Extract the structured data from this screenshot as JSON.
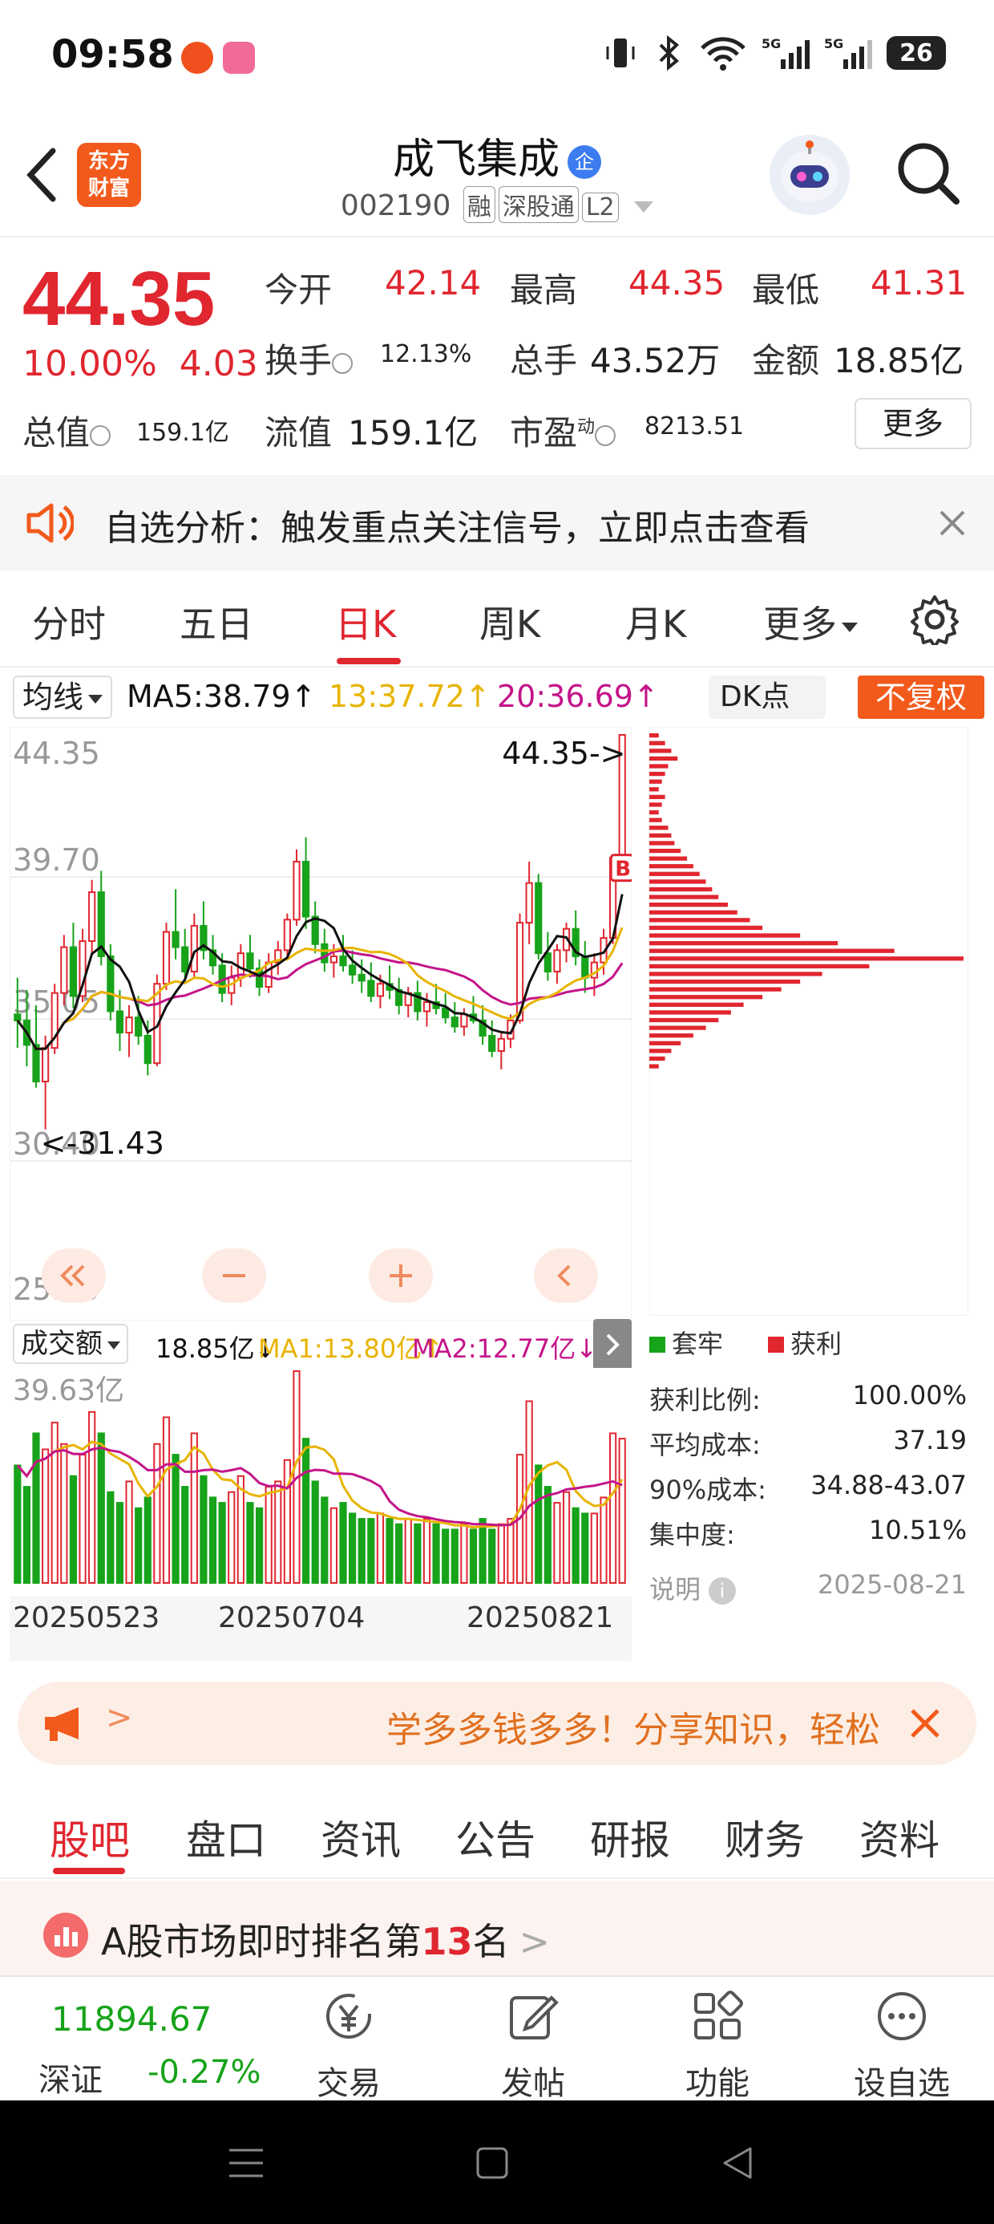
{
  "status_bar": {
    "time": "09:58",
    "battery": "26"
  },
  "header": {
    "logo_line1": "东方",
    "logo_line2": "财富",
    "stock_name": "成飞集成",
    "badge": "企",
    "code": "002190",
    "tags": [
      "融",
      "深股通",
      "L2"
    ]
  },
  "quote": {
    "price": "44.35",
    "change_pct": "10.00%",
    "change": "4.03",
    "open_label": "今开",
    "open": "42.14",
    "high_label": "最高",
    "high": "44.35",
    "low_label": "最低",
    "low": "41.31",
    "turnover_label": "换手",
    "turnover": "12.13%",
    "volume_label": "总手",
    "volume": "43.52万",
    "amount_label": "金额",
    "amount": "18.85亿",
    "mktcap_label": "总值",
    "mktcap": "159.1亿",
    "float_label": "流值",
    "float": "159.1亿",
    "pe_label": "市盈",
    "pe_sup": "动",
    "pe": "8213.51",
    "more": "更多"
  },
  "notice": {
    "text": "自选分析：触发重点关注信号，立即点击查看"
  },
  "chart_tabs": [
    {
      "label": "分时"
    },
    {
      "label": "五日"
    },
    {
      "label": "日K"
    },
    {
      "label": "周K"
    },
    {
      "label": "月K"
    },
    {
      "label": "更多"
    }
  ],
  "ma_row": {
    "select": "均线",
    "ma5": "MA5:38.79↑",
    "ma13": "13:37.72↑",
    "ma20": "20:36.69↑",
    "dk": "DK点",
    "fq": "不复权"
  },
  "colors": {
    "up": "#e0262f",
    "down": "#17a31a",
    "ma5": "#111111",
    "ma13": "#e8b400",
    "ma20": "#c4148a",
    "accent": "#f25a1c"
  },
  "chart_data": {
    "type": "candlestick",
    "y_ticks": [
      "44.35",
      "39.70",
      "35.05",
      "30.40",
      "25.75"
    ],
    "ylim": [
      25.75,
      44.35
    ],
    "max_label": "44.35->",
    "min_label": "<-31.43",
    "buy_marker": "B",
    "volume": {
      "select": "成交额",
      "value": "18.85亿↓",
      "ma1": "MA1:13.80亿↑",
      "ma2": "MA2:12.77亿↓",
      "max_label": "39.63亿"
    },
    "x_labels": [
      "20250523",
      "20250704",
      "20250821"
    ],
    "candles": [
      [
        35.2,
        36.4,
        34.1,
        35.0
      ],
      [
        35.0,
        36.0,
        33.5,
        34.2
      ],
      [
        34.2,
        35.5,
        32.8,
        33.0
      ],
      [
        33.0,
        34.5,
        31.43,
        34.1
      ],
      [
        34.1,
        36.2,
        33.9,
        35.9
      ],
      [
        35.9,
        37.8,
        35.5,
        37.4
      ],
      [
        37.4,
        38.2,
        35.4,
        35.8
      ],
      [
        35.8,
        38.0,
        35.6,
        37.6
      ],
      [
        37.6,
        39.6,
        37.2,
        39.2
      ],
      [
        39.2,
        39.9,
        36.8,
        37.1
      ],
      [
        37.1,
        37.5,
        35.0,
        35.3
      ],
      [
        35.3,
        36.0,
        34.0,
        34.6
      ],
      [
        34.6,
        35.5,
        33.8,
        35.1
      ],
      [
        35.1,
        35.8,
        34.2,
        34.5
      ],
      [
        34.5,
        35.0,
        33.2,
        33.6
      ],
      [
        33.6,
        36.5,
        33.5,
        36.2
      ],
      [
        36.2,
        38.2,
        36.0,
        37.9
      ],
      [
        37.9,
        39.3,
        37.0,
        37.4
      ],
      [
        37.4,
        38.0,
        36.2,
        36.6
      ],
      [
        36.6,
        38.5,
        36.4,
        38.1
      ],
      [
        38.1,
        38.9,
        37.0,
        37.3
      ],
      [
        37.3,
        37.8,
        36.5,
        36.8
      ],
      [
        36.8,
        37.2,
        35.6,
        35.9
      ],
      [
        35.9,
        36.8,
        35.5,
        36.4
      ],
      [
        36.4,
        37.5,
        36.1,
        37.2
      ],
      [
        37.2,
        37.8,
        36.4,
        36.7
      ],
      [
        36.7,
        37.0,
        35.8,
        36.1
      ],
      [
        36.1,
        37.2,
        35.9,
        36.9
      ],
      [
        36.9,
        37.6,
        36.5,
        37.3
      ],
      [
        37.3,
        38.5,
        37.0,
        38.3
      ],
      [
        38.3,
        40.6,
        38.1,
        40.2
      ],
      [
        40.2,
        41.0,
        38.0,
        38.4
      ],
      [
        38.4,
        38.9,
        37.2,
        37.5
      ],
      [
        37.5,
        38.0,
        36.6,
        36.9
      ],
      [
        36.9,
        37.5,
        36.4,
        37.1
      ],
      [
        37.1,
        37.8,
        36.6,
        36.8
      ],
      [
        36.8,
        37.3,
        36.2,
        36.5
      ],
      [
        36.5,
        37.0,
        35.9,
        36.3
      ],
      [
        36.3,
        36.9,
        35.6,
        35.8
      ],
      [
        35.8,
        36.5,
        35.4,
        36.2
      ],
      [
        36.2,
        36.8,
        35.7,
        36.0
      ],
      [
        36.0,
        36.4,
        35.2,
        35.5
      ],
      [
        35.5,
        36.1,
        35.1,
        35.9
      ],
      [
        35.9,
        36.3,
        35.0,
        35.3
      ],
      [
        35.3,
        35.9,
        34.8,
        35.6
      ],
      [
        35.6,
        36.2,
        35.2,
        35.4
      ],
      [
        35.4,
        35.9,
        34.9,
        35.1
      ],
      [
        35.1,
        35.6,
        34.6,
        34.8
      ],
      [
        34.8,
        35.4,
        34.5,
        35.2
      ],
      [
        35.2,
        35.8,
        34.9,
        35.0
      ],
      [
        35.0,
        35.5,
        34.2,
        34.5
      ],
      [
        34.5,
        35.0,
        33.8,
        34.0
      ],
      [
        34.0,
        34.6,
        33.4,
        34.4
      ],
      [
        34.4,
        35.2,
        34.1,
        35.0
      ],
      [
        35.0,
        38.5,
        34.9,
        38.2
      ],
      [
        38.2,
        40.2,
        37.5,
        39.5
      ],
      [
        39.5,
        39.8,
        37.0,
        37.2
      ],
      [
        37.2,
        37.9,
        36.3,
        36.6
      ],
      [
        36.6,
        37.5,
        36.2,
        37.3
      ],
      [
        37.3,
        38.2,
        36.9,
        38.0
      ],
      [
        38.0,
        38.6,
        36.8,
        37.1
      ],
      [
        37.1,
        37.6,
        35.9,
        36.4
      ],
      [
        36.4,
        37.2,
        35.8,
        36.9
      ],
      [
        36.9,
        38.0,
        36.5,
        37.7
      ],
      [
        37.7,
        40.3,
        37.5,
        40.32
      ],
      [
        40.32,
        44.35,
        40.2,
        44.35
      ]
    ],
    "volumes": [
      22,
      18,
      28,
      25,
      30,
      26,
      20,
      24,
      32,
      28,
      17,
      15,
      19,
      14,
      16,
      26,
      31,
      24,
      18,
      28,
      20,
      16,
      15,
      17,
      20,
      15,
      14,
      18,
      19,
      23,
      39.63,
      27,
      19,
      16,
      14,
      15,
      13,
      12,
      12,
      13,
      12,
      11,
      12,
      11,
      12,
      11,
      10,
      10,
      11,
      10,
      12,
      10,
      11,
      12,
      24,
      34,
      22,
      18,
      15,
      17,
      14,
      13,
      13,
      16,
      28,
      27
    ],
    "chip_distribution": [
      3,
      5,
      7,
      9,
      6,
      5,
      4,
      3,
      5,
      4,
      3,
      4,
      6,
      7,
      8,
      10,
      12,
      14,
      16,
      18,
      20,
      22,
      25,
      28,
      32,
      36,
      48,
      60,
      78,
      100,
      70,
      55,
      48,
      42,
      36,
      30,
      26,
      22,
      18,
      14,
      10,
      7,
      5,
      3
    ],
    "chip_stats": {
      "legend_loss": "套牢",
      "legend_profit": "获利",
      "rows": [
        {
          "label": "获利比例:",
          "value": "100.00%"
        },
        {
          "label": "平均成本:",
          "value": "37.19"
        },
        {
          "label": "90%成本:",
          "value": "34.88-43.07"
        },
        {
          "label": "集中度:",
          "value": "10.51%"
        }
      ],
      "note_label": "说明",
      "date": "2025-08-21"
    }
  },
  "banner": {
    "text": "学多多钱多多！分享知识，轻松"
  },
  "bottom_tabs": [
    {
      "label": "股吧"
    },
    {
      "label": "盘口"
    },
    {
      "label": "资讯"
    },
    {
      "label": "公告"
    },
    {
      "label": "研报"
    },
    {
      "label": "财务"
    },
    {
      "label": "资料"
    }
  ],
  "rank": {
    "prefix": "A股市场即时排名第",
    "num": "13",
    "suffix": "名"
  },
  "bottom_bar": {
    "index_value": "11894.67",
    "index_name": "深证",
    "index_change": "-0.27%",
    "items": [
      {
        "label": "交易"
      },
      {
        "label": "发帖"
      },
      {
        "label": "功能"
      },
      {
        "label": "设自选"
      }
    ]
  }
}
